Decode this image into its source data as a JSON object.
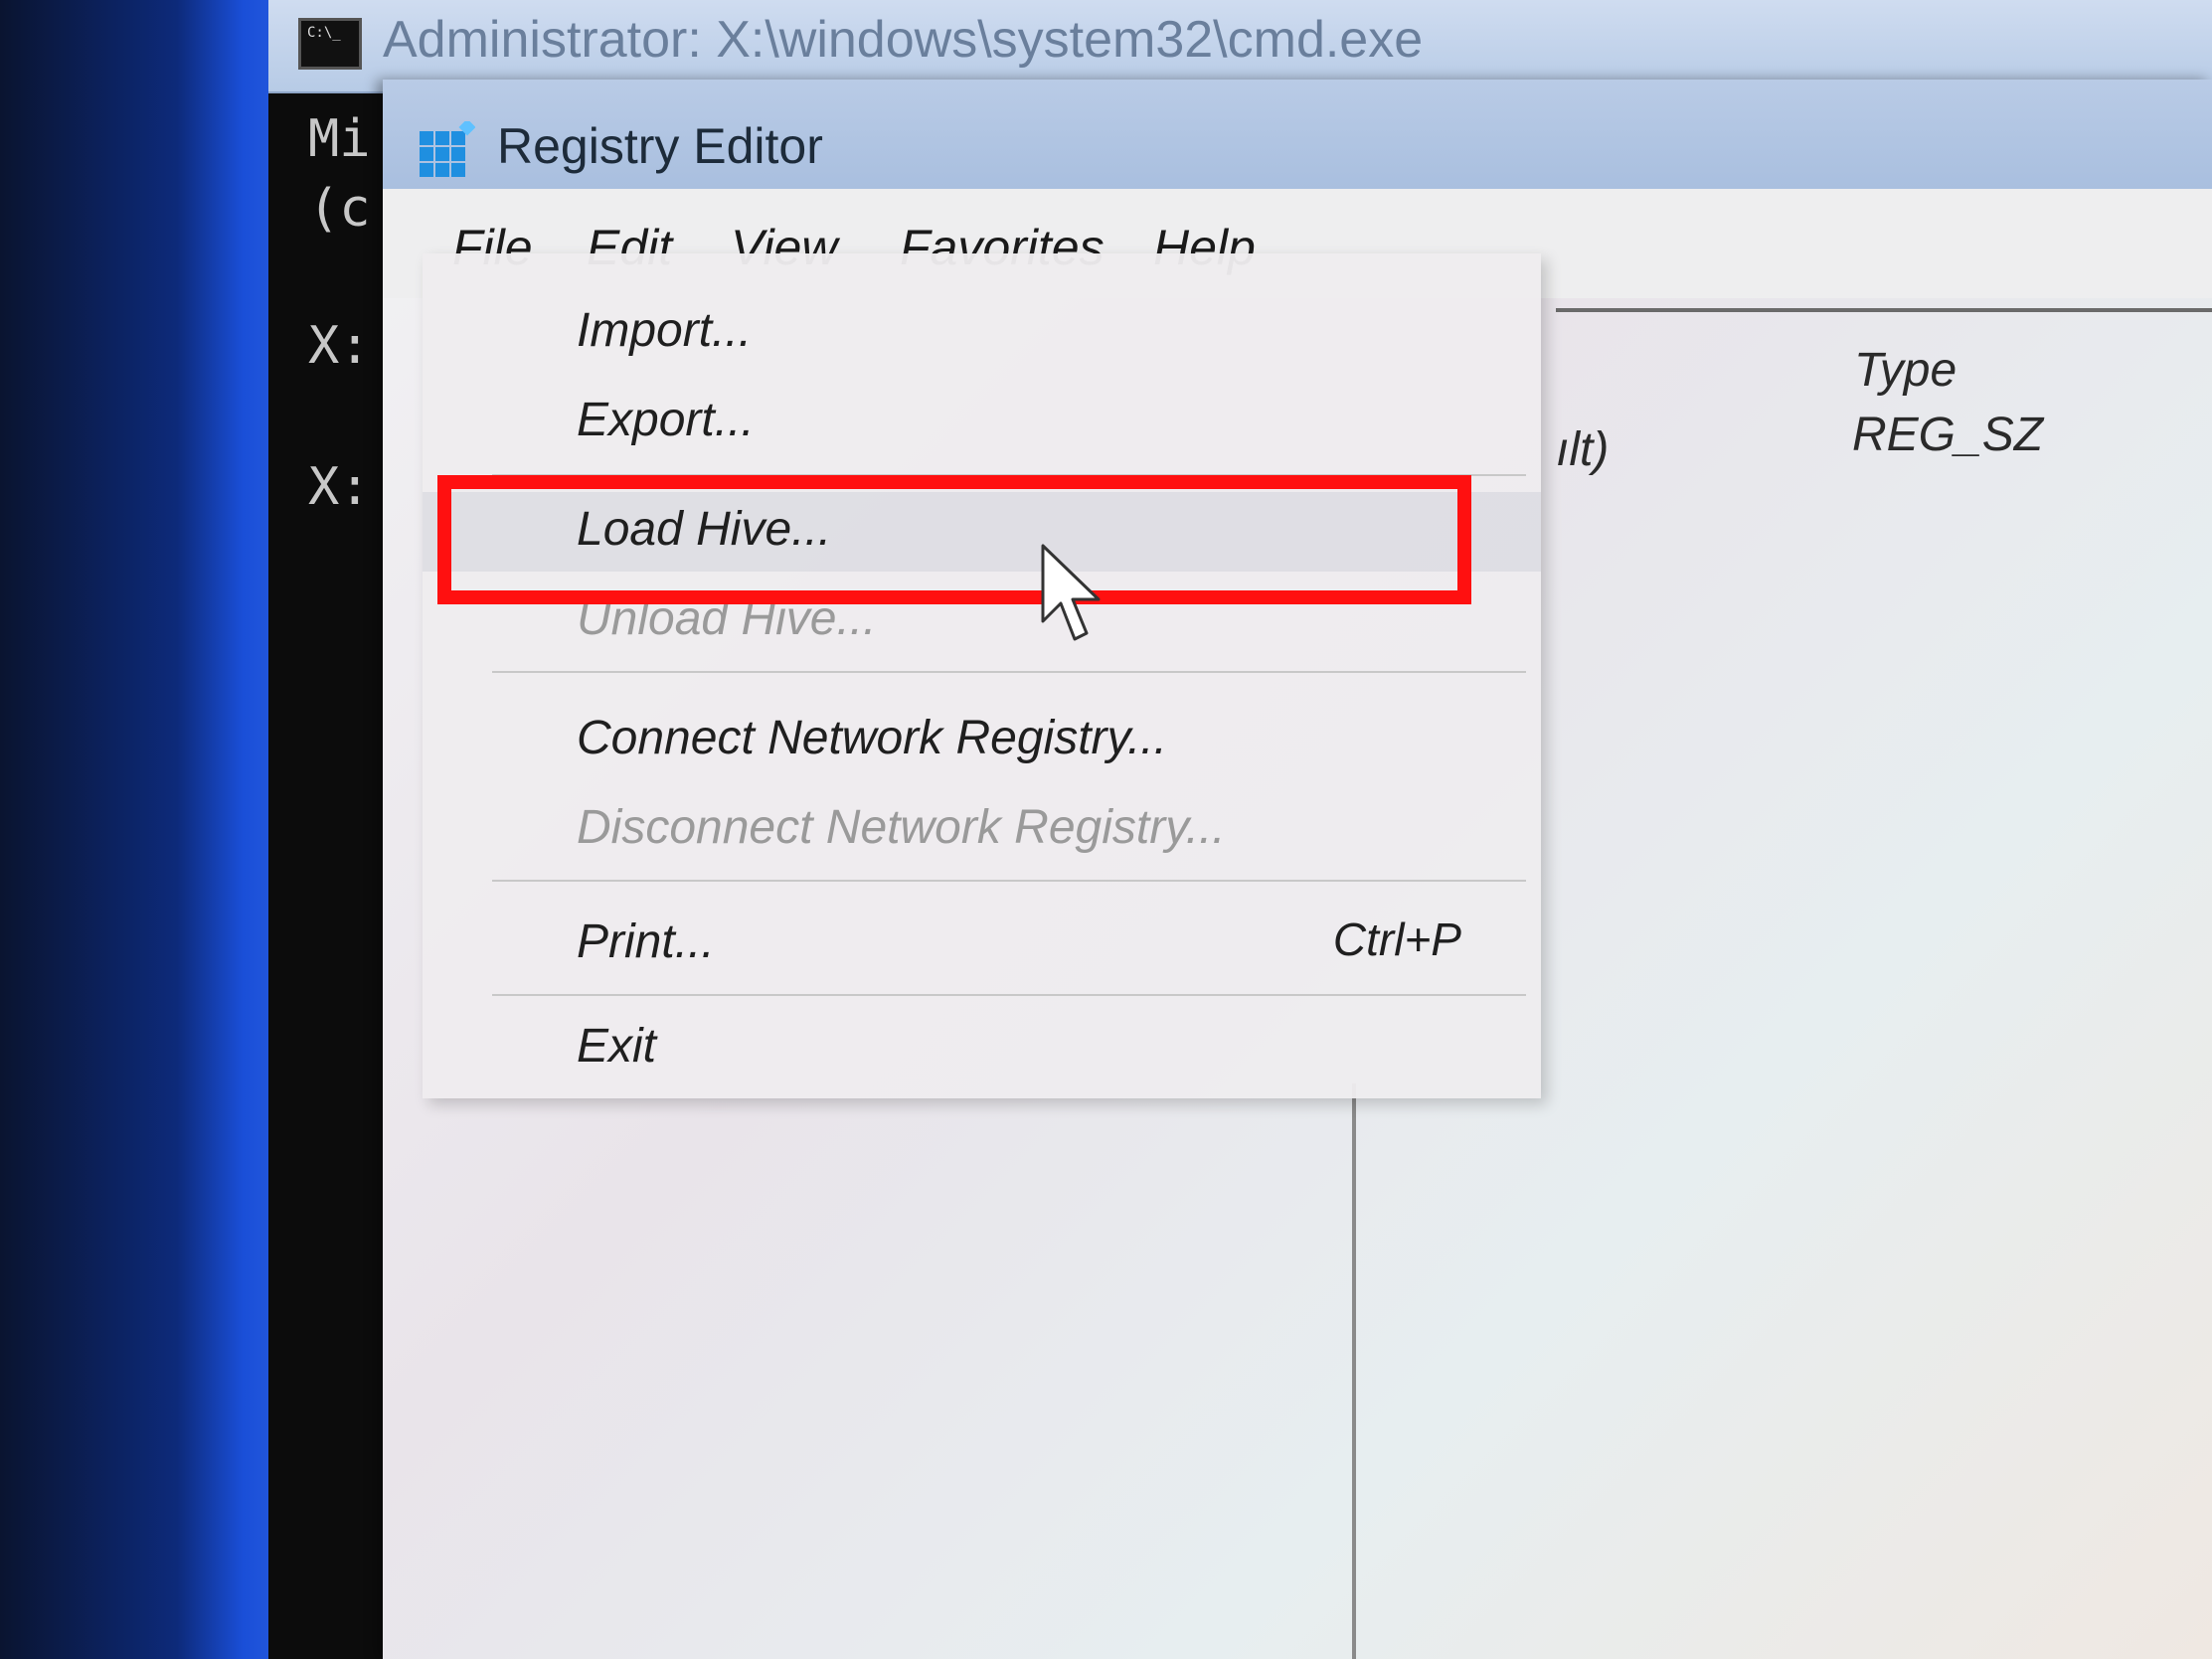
{
  "cmd": {
    "title": "Administrator: X:\\windows\\system32\\cmd.exe",
    "icon": "C:\\_",
    "lines": [
      "Mi",
      "(c",
      "X:",
      "X:"
    ]
  },
  "regedit": {
    "title": "Registry Editor",
    "menubar": [
      "File",
      "Edit",
      "View",
      "Favorites",
      "Help"
    ],
    "list": {
      "type_header": "Type",
      "default_name": "ılt)",
      "default_type": "REG_SZ"
    }
  },
  "file_menu": {
    "items": [
      {
        "label": "Import...",
        "disabled": false
      },
      {
        "label": "Export...",
        "disabled": false
      },
      {
        "label": "Load Hive...",
        "disabled": false
      },
      {
        "label": "Unload Hive...",
        "disabled": true
      },
      {
        "label": "Connect Network Registry...",
        "disabled": false
      },
      {
        "label": "Disconnect Network Registry...",
        "disabled": true
      },
      {
        "label": "Print...",
        "disabled": false,
        "shortcut": "Ctrl+P"
      },
      {
        "label": "Exit",
        "disabled": false
      }
    ]
  },
  "colors": {
    "highlight": "#ff1010",
    "titlebar": "#b9cbe6",
    "desktop_blue": "#1a4fd8"
  }
}
